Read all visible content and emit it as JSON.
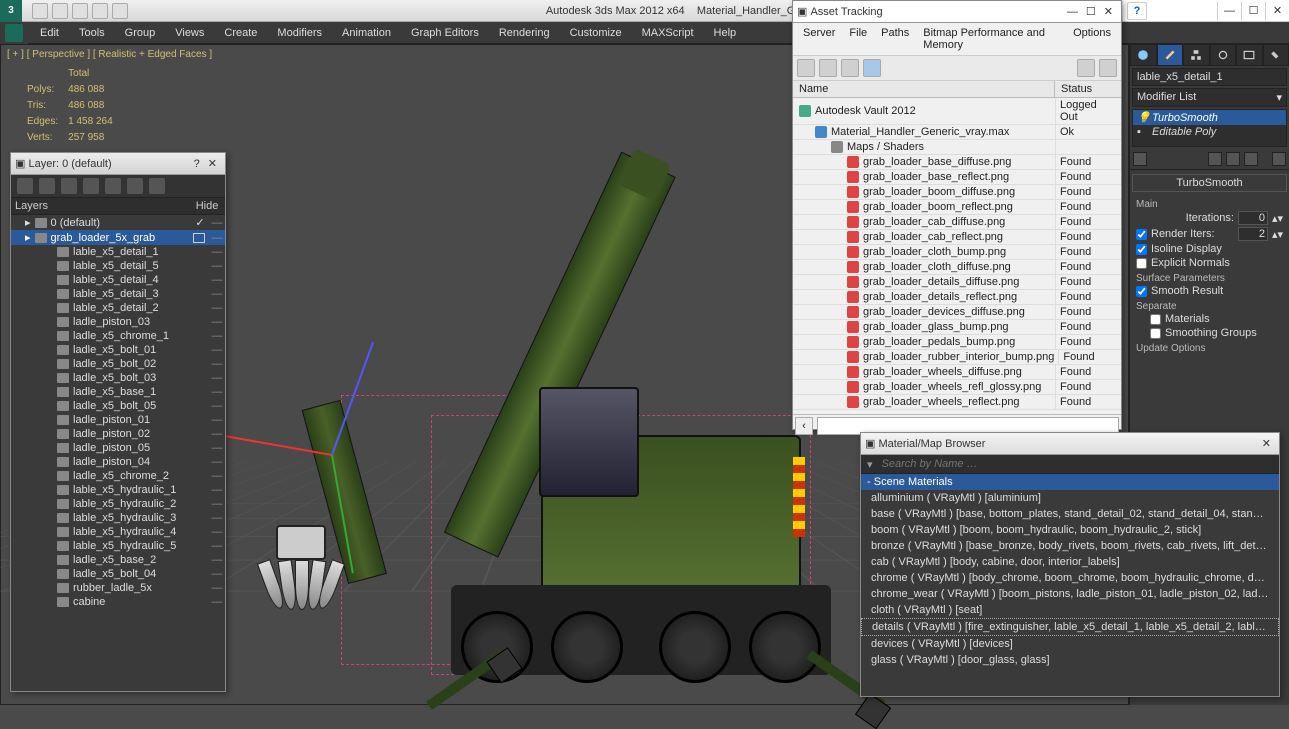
{
  "title_left": "Autodesk 3ds Max  2012 x64",
  "title_right": "Material_Handler_Generic_vray.max",
  "menubar": [
    "Edit",
    "Tools",
    "Group",
    "Views",
    "Create",
    "Modifiers",
    "Animation",
    "Graph Editors",
    "Rendering",
    "Customize",
    "MAXScript",
    "Help"
  ],
  "viewport_label": "[ + ] [ Perspective ] [ Realistic + Edged Faces ]",
  "stats": {
    "header": "Total",
    "rows": [
      [
        "Polys:",
        "486 088"
      ],
      [
        "Tris:",
        "486 088"
      ],
      [
        "Edges:",
        "1 458 264"
      ],
      [
        "Verts:",
        "257 958"
      ]
    ]
  },
  "layer_window": {
    "title": "Layer: 0 (default)",
    "columns": [
      "Layers",
      "Hide"
    ],
    "rows": [
      {
        "indent": 0,
        "name": "0 (default)",
        "sel": false,
        "type": "layer",
        "check": true
      },
      {
        "indent": 0,
        "name": "grab_loader_5x_grab",
        "sel": true,
        "type": "layer",
        "box": true
      },
      {
        "indent": 1,
        "name": "lable_x5_detail_1"
      },
      {
        "indent": 1,
        "name": "lable_x5_detail_5"
      },
      {
        "indent": 1,
        "name": "lable_x5_detail_4"
      },
      {
        "indent": 1,
        "name": "lable_x5_detail_3"
      },
      {
        "indent": 1,
        "name": "lable_x5_detail_2"
      },
      {
        "indent": 1,
        "name": "ladle_piston_03"
      },
      {
        "indent": 1,
        "name": "ladle_x5_chrome_1"
      },
      {
        "indent": 1,
        "name": "ladle_x5_bolt_01"
      },
      {
        "indent": 1,
        "name": "ladle_x5_bolt_02"
      },
      {
        "indent": 1,
        "name": "ladle_x5_bolt_03"
      },
      {
        "indent": 1,
        "name": "ladle_x5_base_1"
      },
      {
        "indent": 1,
        "name": "ladle_x5_bolt_05"
      },
      {
        "indent": 1,
        "name": "ladle_piston_01"
      },
      {
        "indent": 1,
        "name": "ladle_piston_02"
      },
      {
        "indent": 1,
        "name": "ladle_piston_05"
      },
      {
        "indent": 1,
        "name": "ladle_piston_04"
      },
      {
        "indent": 1,
        "name": "ladle_x5_chrome_2"
      },
      {
        "indent": 1,
        "name": "lable_x5_hydraulic_1"
      },
      {
        "indent": 1,
        "name": "lable_x5_hydraulic_2"
      },
      {
        "indent": 1,
        "name": "lable_x5_hydraulic_3"
      },
      {
        "indent": 1,
        "name": "lable_x5_hydraulic_4"
      },
      {
        "indent": 1,
        "name": "lable_x5_hydraulic_5"
      },
      {
        "indent": 1,
        "name": "ladle_x5_base_2"
      },
      {
        "indent": 1,
        "name": "ladle_x5_bolt_04"
      },
      {
        "indent": 1,
        "name": "rubber_ladle_5x"
      },
      {
        "indent": 1,
        "name": "cabine"
      }
    ]
  },
  "asset_window": {
    "title": "Asset Tracking",
    "menus": [
      "Server",
      "File",
      "Paths",
      "Bitmap Performance and Memory",
      "Options"
    ],
    "columns": [
      "Name",
      "Status"
    ],
    "rows": [
      {
        "indent": 0,
        "icon": "v",
        "name": "Autodesk Vault 2012",
        "status": "Logged Out"
      },
      {
        "indent": 1,
        "icon": "m",
        "name": "Material_Handler_Generic_vray.max",
        "status": "Ok"
      },
      {
        "indent": 2,
        "icon": "f",
        "name": "Maps / Shaders",
        "status": ""
      },
      {
        "indent": 3,
        "icon": "r",
        "name": "grab_loader_base_diffuse.png",
        "status": "Found"
      },
      {
        "indent": 3,
        "icon": "r",
        "name": "grab_loader_base_reflect.png",
        "status": "Found"
      },
      {
        "indent": 3,
        "icon": "r",
        "name": "grab_loader_boom_diffuse.png",
        "status": "Found"
      },
      {
        "indent": 3,
        "icon": "r",
        "name": "grab_loader_boom_reflect.png",
        "status": "Found"
      },
      {
        "indent": 3,
        "icon": "r",
        "name": "grab_loader_cab_diffuse.png",
        "status": "Found"
      },
      {
        "indent": 3,
        "icon": "r",
        "name": "grab_loader_cab_reflect.png",
        "status": "Found"
      },
      {
        "indent": 3,
        "icon": "r",
        "name": "grab_loader_cloth_bump.png",
        "status": "Found"
      },
      {
        "indent": 3,
        "icon": "r",
        "name": "grab_loader_cloth_diffuse.png",
        "status": "Found"
      },
      {
        "indent": 3,
        "icon": "r",
        "name": "grab_loader_details_diffuse.png",
        "status": "Found"
      },
      {
        "indent": 3,
        "icon": "r",
        "name": "grab_loader_details_reflect.png",
        "status": "Found"
      },
      {
        "indent": 3,
        "icon": "r",
        "name": "grab_loader_devices_diffuse.png",
        "status": "Found"
      },
      {
        "indent": 3,
        "icon": "r",
        "name": "grab_loader_glass_bump.png",
        "status": "Found"
      },
      {
        "indent": 3,
        "icon": "r",
        "name": "grab_loader_pedals_bump.png",
        "status": "Found"
      },
      {
        "indent": 3,
        "icon": "r",
        "name": "grab_loader_rubber_interior_bump.png",
        "status": "Found"
      },
      {
        "indent": 3,
        "icon": "r",
        "name": "grab_loader_wheels_diffuse.png",
        "status": "Found"
      },
      {
        "indent": 3,
        "icon": "r",
        "name": "grab_loader_wheels_refl_glossy.png",
        "status": "Found"
      },
      {
        "indent": 3,
        "icon": "r",
        "name": "grab_loader_wheels_reflect.png",
        "status": "Found"
      }
    ]
  },
  "mat_window": {
    "title": "Material/Map Browser",
    "search_placeholder": "Search by Name …",
    "category": "Scene Materials",
    "rows": [
      "alluminium ( VRayMtl ) [aluminium]",
      "base ( VRayMtl ) [base, bottom_plates, stand_detail_02, stand_detail_04, stand_detai…",
      "boom ( VRayMtl ) [boom, boom_hydraulic, boom_hydraulic_2, stick]",
      "bronze ( VRayMtl ) [base_bronze, body_rivets, boom_rivets, cab_rivets, lift_details_ri…",
      "cab ( VRayMtl ) [body, cabine, door, interior_labels]",
      "chrome ( VRayMtl ) [body_chrome, boom_chrome, boom_hydraulic_chrome, door_ch…",
      "chrome_wear ( VRayMtl ) [boom_pistons, ladle_piston_01, ladle_piston_02, ladle_pist…",
      "cloth ( VRayMtl ) [seat]",
      "details ( VRayMtl ) [fire_extinguisher, lable_x5_detail_1, lable_x5_detail_2, lable_x5_…",
      "devices ( VRayMtl ) [devices]",
      "glass ( VRayMtl ) [door_glass, glass]"
    ],
    "selected_index": 8
  },
  "cmd": {
    "object_name": "lable_x5_detail_1",
    "modlist_label": "Modifier List",
    "stack": [
      "TurboSmooth",
      "Editable Poly"
    ],
    "rollout1": "TurboSmooth",
    "main": "Main",
    "iter_label": "Iterations:",
    "iter_val": "0",
    "render_label": "Render Iters:",
    "render_val": "2",
    "isoline": "Isoline Display",
    "explicit": "Explicit Normals",
    "surf_params": "Surface Parameters",
    "smooth_result": "Smooth Result",
    "separate": "Separate",
    "materials": "Materials",
    "smoothing_groups": "Smoothing Groups",
    "update_options": "Update Options"
  }
}
